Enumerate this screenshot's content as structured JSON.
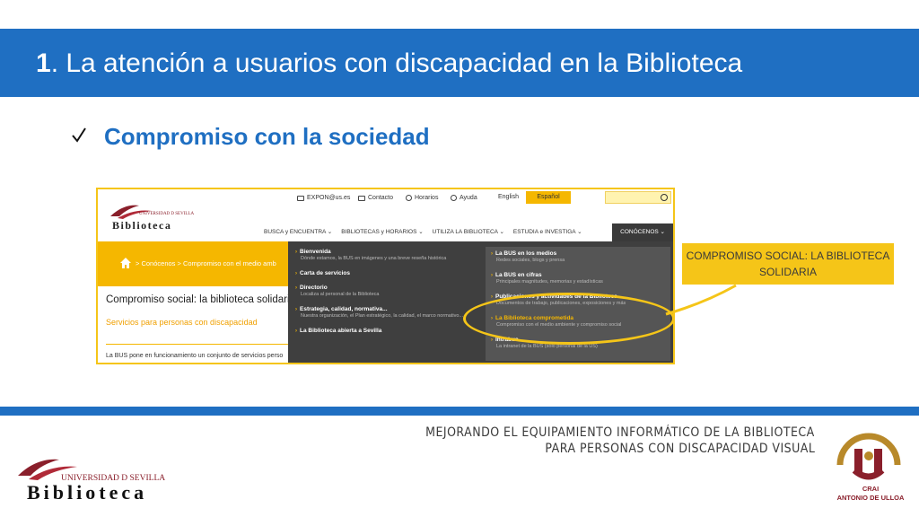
{
  "slide": {
    "title_number": "1",
    "title_rest": ". La atención a usuarios con discapacidad en la Biblioteca",
    "subtitle": "Compromiso con la sociedad",
    "callout": {
      "line1": "COMPROMISO SOCIAL: LA BIBLIOTECA",
      "line2": "SOLIDARIA"
    },
    "footer": {
      "line1": "MEJORANDO EL EQUIPAMIENTO INFORMÁTICO DE LA BIBLIOTECA",
      "line2": "PARA PERSONAS CON DISCAPACIDAD VISUAL"
    },
    "logo_left": {
      "university": "UNIVERSIDAD D SEVILLA",
      "name": "Biblioteca"
    },
    "logo_right": {
      "line1": "CRAI",
      "line2": "ANTONIO DE ULLOA"
    }
  },
  "site": {
    "toplinks": [
      {
        "label": "EXPON@us.es",
        "icon": "mail-icon"
      },
      {
        "label": "Contacto",
        "icon": "mail-icon"
      },
      {
        "label": "Horarios",
        "icon": "clock-icon"
      },
      {
        "label": "Ayuda",
        "icon": "help-icon"
      }
    ],
    "lang_en": "English",
    "lang_es": "Español",
    "logo_university": "UNIVERSIDAD D SEVILLA",
    "logo_name": "Biblioteca",
    "nav": [
      {
        "label": "BUSCA y ENCUENTRA ⌄"
      },
      {
        "label": "BIBLIOTECAS y HORARIOS ⌄"
      },
      {
        "label": "UTILIZA LA BIBLIOTECA ⌄"
      },
      {
        "label": "ESTUDIA e INVESTIGA ⌄"
      },
      {
        "label": "CONÓCENOS ⌄"
      }
    ],
    "breadcrumb": "> Conócenos > Compromiso con el medio amb",
    "page_title": "Compromiso social: la biblioteca solidaria",
    "page_subtitle": "Servicios para personas con discapacidad",
    "page_text": "La BUS pone en funcionamiento un conjunto de servicios perso",
    "menu_left": [
      {
        "label": "Bienvenida",
        "sub": "Dónde estamos, la BUS en imágenes y una breve reseña histórica"
      },
      {
        "label": "Carta de servicios",
        "sub": ""
      },
      {
        "label": "Directorio",
        "sub": "Localiza al personal de la Biblioteca"
      },
      {
        "label": "Estrategia, calidad, normativa...",
        "sub": "Nuestra organización, el Plan estratégico, la calidad, el marco normativo..."
      },
      {
        "label": "La Biblioteca abierta a Sevilla",
        "sub": ""
      }
    ],
    "menu_right": [
      {
        "label": "La BUS en los medios",
        "sub": "Redes sociales, blogs y prensa"
      },
      {
        "label": "La BUS en cifras",
        "sub": "Principales magnitudes, memorias y estadísticas"
      },
      {
        "label": "Publicaciones y actividades de la Biblioteca",
        "sub": "Documentos de trabajo, publicaciones, exposiciones y más"
      },
      {
        "label": "La Biblioteca comprometida",
        "sub": "Compromiso con el medio ambiente y compromiso social"
      },
      {
        "label": "Intrabus",
        "sub": "La intranet de la BUS (sólo personal de la US)"
      }
    ]
  },
  "colors": {
    "brand_blue": "#1f6fc2",
    "accent_yellow": "#f5c518",
    "dark_menu": "#3f3f3f",
    "univ_red": "#8a1f2b"
  }
}
